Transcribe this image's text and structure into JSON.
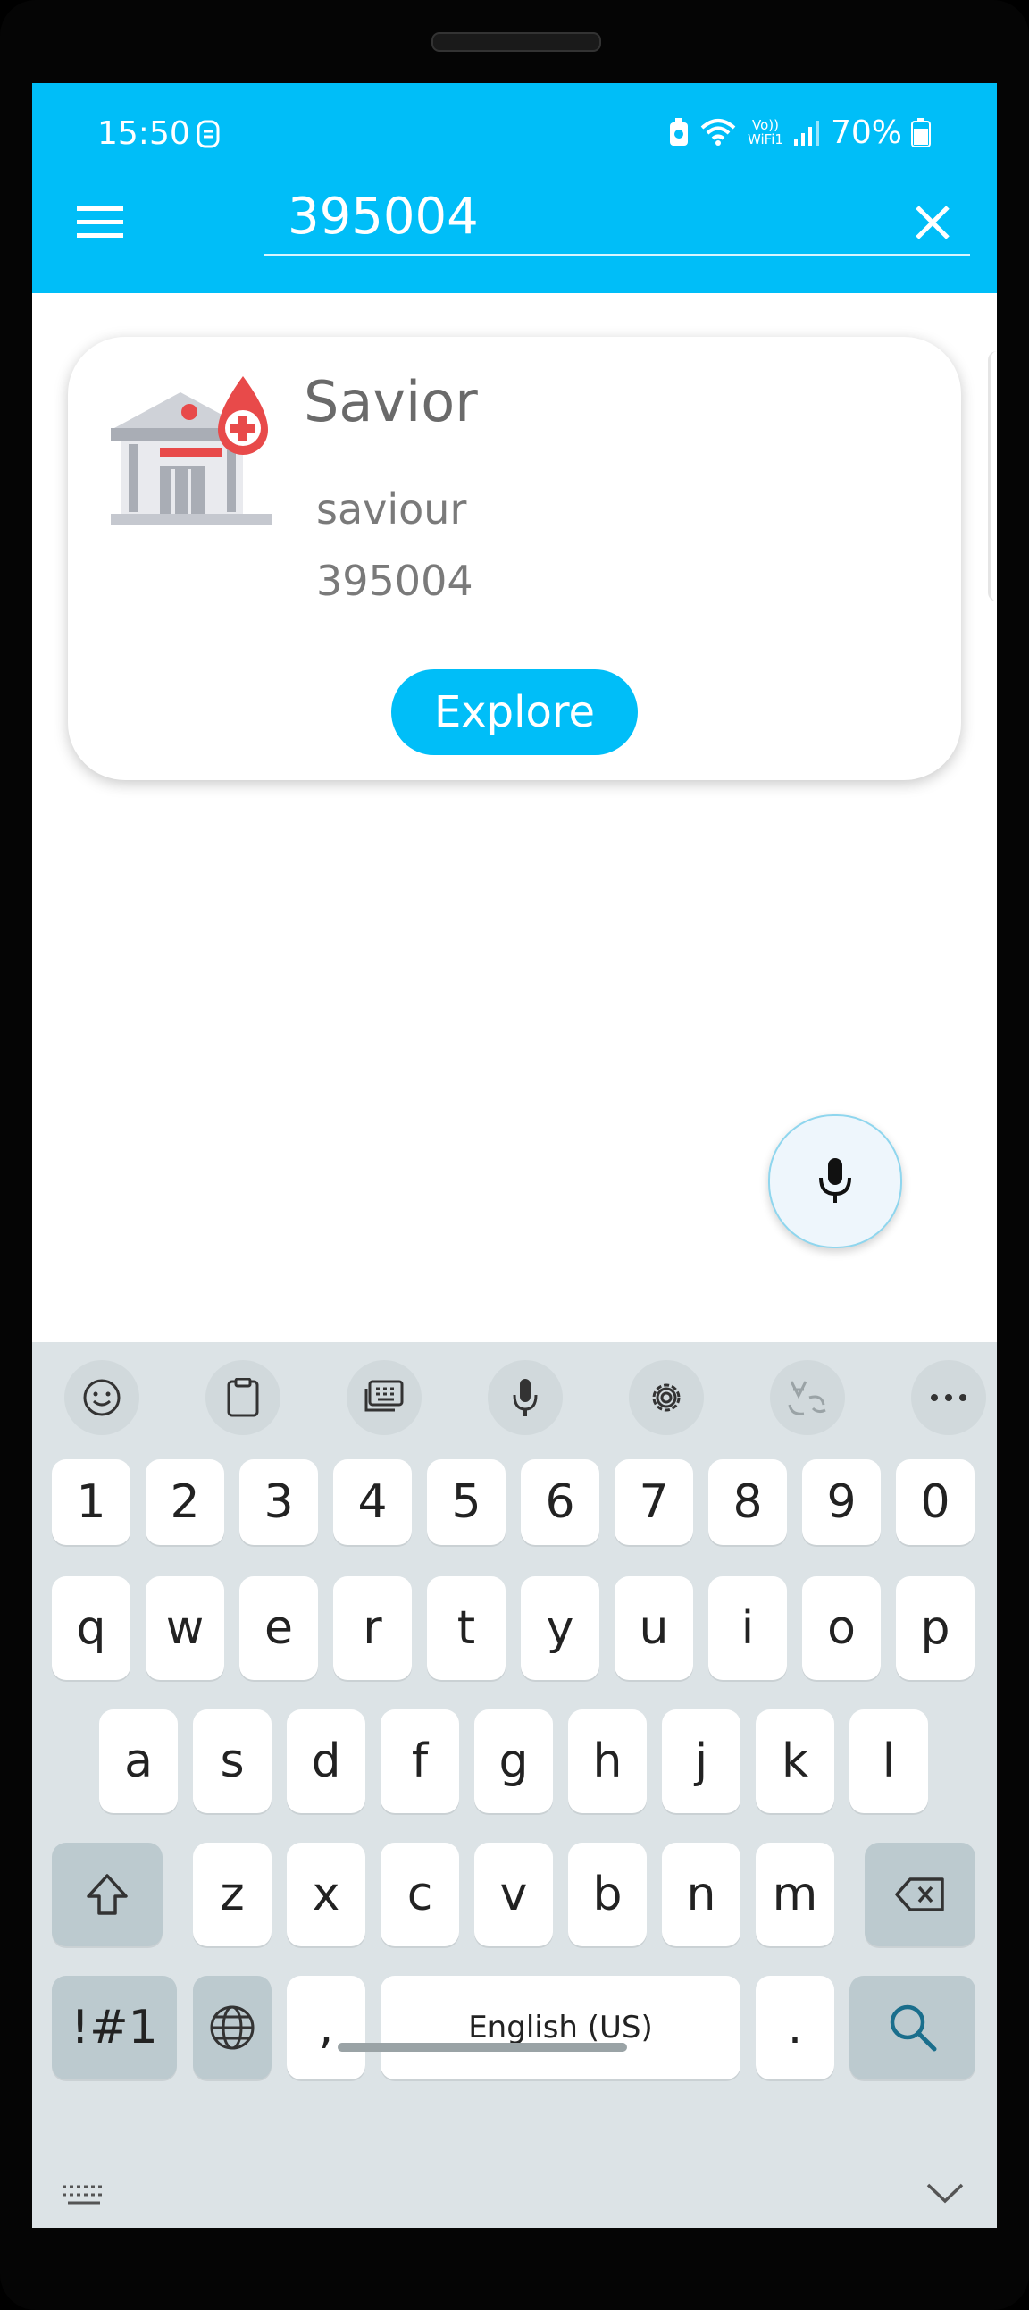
{
  "status": {
    "time": "15:50",
    "battery": "70%",
    "network": "Vo)) WiFi1"
  },
  "search": {
    "value": "395004"
  },
  "card": {
    "title": "Savior",
    "subtitle": "saviour",
    "pincode": "395004",
    "button_label": "Explore"
  },
  "keyboard": {
    "number_row": [
      "1",
      "2",
      "3",
      "4",
      "5",
      "6",
      "7",
      "8",
      "9",
      "0"
    ],
    "row1": [
      "q",
      "w",
      "e",
      "r",
      "t",
      "y",
      "u",
      "i",
      "o",
      "p"
    ],
    "row2": [
      "a",
      "s",
      "d",
      "f",
      "g",
      "h",
      "j",
      "k",
      "l"
    ],
    "row3": [
      "z",
      "x",
      "c",
      "v",
      "b",
      "n",
      "m"
    ],
    "symbols_label": "!#1",
    "comma": ",",
    "space_label": "English (US)",
    "period": "."
  },
  "colors": {
    "accent": "#00bef8",
    "keyboard_bg": "#dce3e6"
  },
  "icons": [
    "menu-icon",
    "close-icon",
    "hospital-blood-icon",
    "microphone-icon",
    "emoji-icon",
    "clipboard-icon",
    "keyboard-mode-icon",
    "settings-icon",
    "translate-icon",
    "more-icon",
    "shift-icon",
    "backspace-icon",
    "globe-icon",
    "search-icon",
    "keyboard-hide-icon",
    "chevron-down-icon"
  ]
}
